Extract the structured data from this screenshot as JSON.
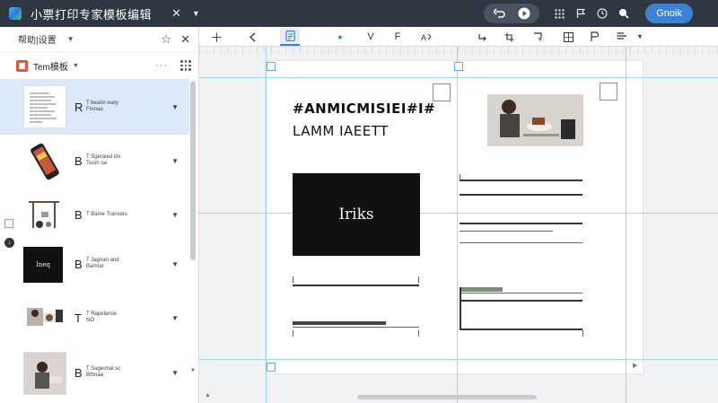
{
  "window": {
    "title": "小票打印专家模板编辑",
    "primary_button": "Gnoik"
  },
  "left_panel": {
    "title": "帮助|设置",
    "sub_label": "Tem模板"
  },
  "templates": [
    {
      "letter": "R",
      "name": "T bealm leaty\nFmnaa"
    },
    {
      "letter": "B",
      "name": "T Sgeraied ids\nToom oa"
    },
    {
      "letter": "B",
      "name": "T Bame Transers"
    },
    {
      "letter": "B",
      "name": "T Jagnan and\nBarmar"
    },
    {
      "letter": "T",
      "name": "T Rapelamie\nNO"
    },
    {
      "letter": "B",
      "name": "T Sageonal sc\nBfhnaa"
    }
  ],
  "template_thumb_text": "Ineq",
  "canvas": {
    "headline": "#ANMICMISIEI#I#",
    "subhead": "LAMM IAEETT",
    "box_text": "Iriks"
  },
  "icons": {
    "titlebar": [
      "app-logo-icon",
      "close-icon",
      "chevron-down-icon",
      "undo-icon",
      "play-icon",
      "grid-icon",
      "flag-icon",
      "clock-icon",
      "search-icon"
    ],
    "toolbar": [
      "plus-icon",
      "cursor-icon",
      "page-icon",
      "dot-icon",
      "v-icon",
      "f-icon",
      "transform-icon",
      "redo-icon",
      "crop-icon",
      "frame-icon",
      "table-icon",
      "paragraph-icon",
      "align-icon"
    ]
  }
}
